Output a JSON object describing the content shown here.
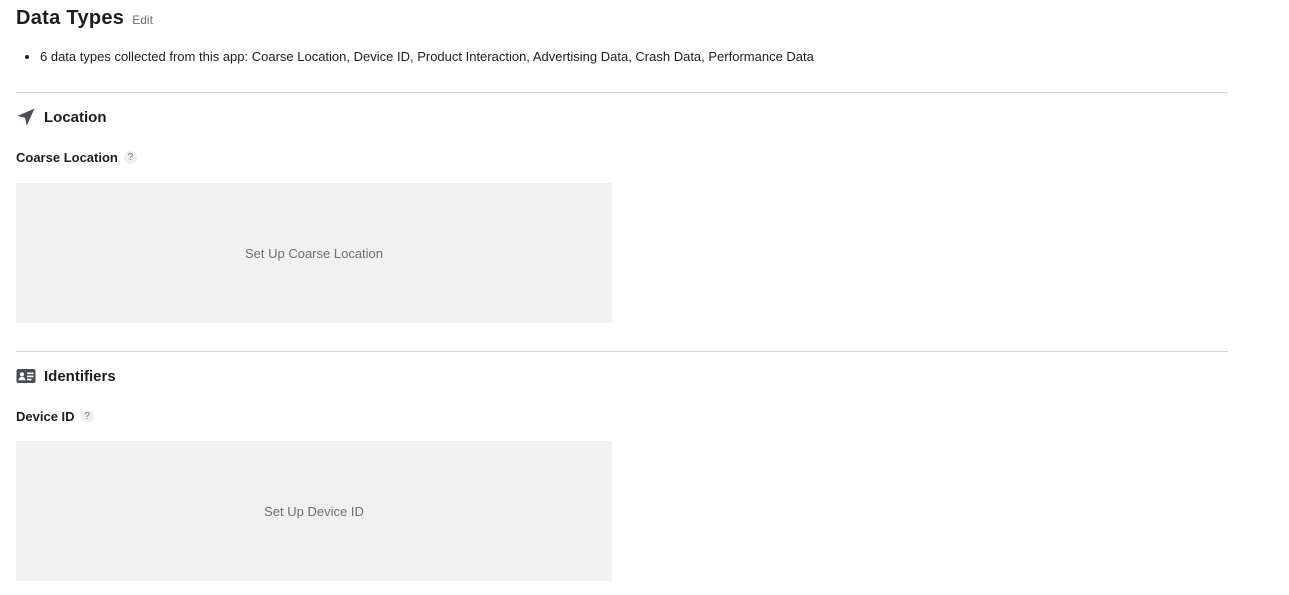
{
  "header": {
    "title": "Data Types",
    "edit_label": "Edit"
  },
  "summary": {
    "items": [
      "6 data types collected from this app: Coarse Location, Device ID, Product Interaction, Advertising Data, Crash Data, Performance Data"
    ]
  },
  "sections": [
    {
      "title": "Location",
      "icon": "location-arrow-icon",
      "item": {
        "name": "Coarse Location",
        "help": "?",
        "setup_label": "Set Up Coarse Location"
      }
    },
    {
      "title": "Identifiers",
      "icon": "id-card-icon",
      "item": {
        "name": "Device ID",
        "help": "?",
        "setup_label": "Set Up Device ID"
      }
    }
  ],
  "colors": {
    "text": "#1d1d1f",
    "muted": "#6e6e73",
    "divider": "#d2d2d7",
    "box": "#f1f1f1",
    "icon": "#4a4f56"
  }
}
